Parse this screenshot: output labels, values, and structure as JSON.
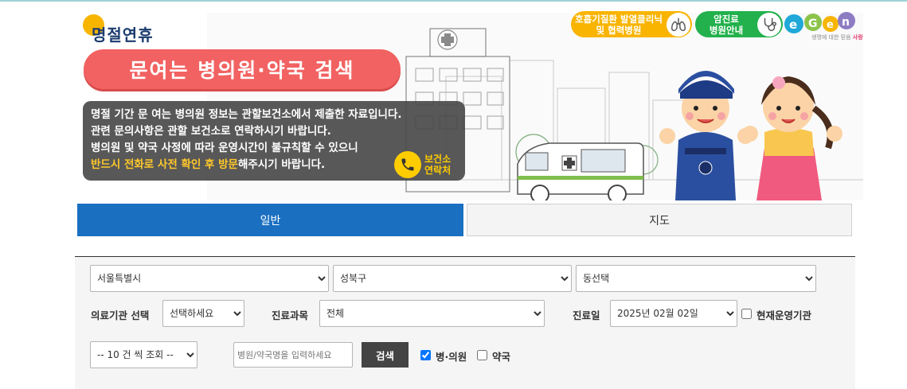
{
  "banner": {
    "holiday_title": "명절연휴",
    "search_title": "문여는 병의원·약국 검색",
    "notice_lines": [
      "명절 기간 문 여는 병의원 정보는 관할보건소에서 제출한 자료입니다.",
      "관련 문의사항은 관할 보건소로 연락하시기 바랍니다.",
      "병의원 및 약국 사정에 따라 운영시간이 불규칙할 수 있으니"
    ],
    "notice_highlight": "반드시 전화로 사전 확인 후 방문",
    "notice_tail": "해주시기 바랍니다.",
    "contact_line1": "보건소",
    "contact_line2": "연락처",
    "fever_line1": "호흡기질환 발열클리닉",
    "fever_line2": "및 협력병원",
    "cancer_line1": "암진료",
    "cancer_line2": "병원안내",
    "egen_tagline_prefix": "생명에 대한 믿음",
    "egen_tagline_suffix": "사랑"
  },
  "tabs": [
    {
      "label": "일반",
      "active": true
    },
    {
      "label": "지도",
      "active": false
    }
  ],
  "filters": {
    "sido": "서울특별시",
    "sigungu": "성북구",
    "dong": "동선택",
    "institution_label": "의료기관 선택",
    "institution": "선택하세요",
    "department_label": "진료과목",
    "department": "전체",
    "date_label": "진료일",
    "date": "2025년 02월 02일",
    "open_now_label": "현재운영기관",
    "open_now_checked": false,
    "page_size": "-- 10 건 씩 조회 --",
    "name_placeholder": "병원/약국명을 입력하세요",
    "search_button": "검색",
    "hospital_label": "병·의원",
    "hospital_checked": true,
    "pharmacy_label": "약국",
    "pharmacy_checked": false
  },
  "colors": {
    "accent_blue": "#1a6fc1",
    "pill_red": "#f26262",
    "highlight_yellow": "#ffc82a",
    "fever_orange": "#f9b400",
    "cancer_green": "#22b14c"
  },
  "icons": [
    "lungs-icon",
    "stethoscope-icon",
    "phone-icon",
    "egen-logo",
    "hospital-building-icon",
    "ambulance-icon",
    "korean-boy-icon",
    "korean-girl-icon"
  ]
}
